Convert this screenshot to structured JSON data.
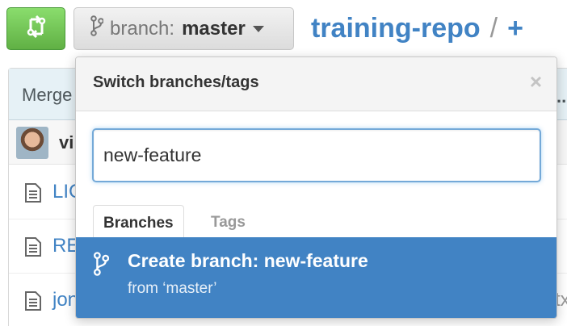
{
  "toolbar": {
    "branch_label": "branch:",
    "branch_value": "master"
  },
  "repo": {
    "name": "training-repo",
    "separator": "/",
    "add_label": "+"
  },
  "background": {
    "commit_header": "Merge",
    "commit_menu": "...",
    "author_name": "vi",
    "files": [
      {
        "name": "LIC",
        "tail": ""
      },
      {
        "name": "RE",
        "tail": ""
      },
      {
        "name": "jon",
        "tail": "tx"
      }
    ]
  },
  "menu": {
    "title": "Switch branches/tags",
    "close_label": "×",
    "filter_value": "new-feature",
    "tabs": [
      {
        "label": "Branches",
        "active": true
      },
      {
        "label": "Tags",
        "active": false
      }
    ],
    "create": {
      "title": "Create branch: new-feature",
      "subtitle": "from ‘master’"
    }
  },
  "colors": {
    "accent": "#4183c4",
    "compare_green": "#6cc644"
  },
  "icons": {
    "compare": "compare-arrows-icon",
    "branch": "git-branch-icon",
    "file": "file-text-icon"
  }
}
